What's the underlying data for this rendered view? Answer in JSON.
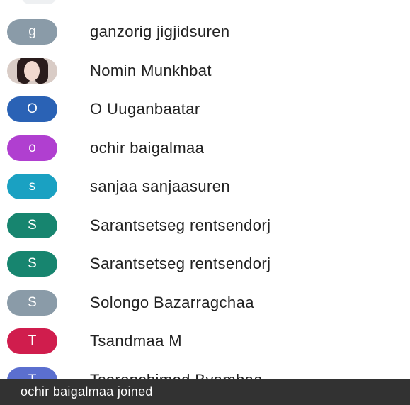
{
  "colors": {
    "gray": "#8a9ba8",
    "blue": "#2a62b5",
    "purple": "#b03fd0",
    "cyan": "#1aa1c2",
    "teal": "#17856f",
    "red": "#d01d4d",
    "indigo": "#5b6fcf",
    "toast_bg": "#323232"
  },
  "participants": [
    {
      "initial": "g",
      "name": "ganzorig jigjidsuren",
      "avatar_color": "#8a9ba8",
      "avatar_icon": "letter-avatar"
    },
    {
      "initial": "",
      "name": "Nomin Munkhbat",
      "avatar_color": "#d9ccc6",
      "avatar_icon": "photo-avatar"
    },
    {
      "initial": "O",
      "name": "O Uuganbaatar",
      "avatar_color": "#2a62b5",
      "avatar_icon": "letter-avatar"
    },
    {
      "initial": "o",
      "name": "ochir baigalmaa",
      "avatar_color": "#b03fd0",
      "avatar_icon": "letter-avatar"
    },
    {
      "initial": "s",
      "name": "sanjaa sanjaasuren",
      "avatar_color": "#1aa1c2",
      "avatar_icon": "letter-avatar"
    },
    {
      "initial": "S",
      "name": "Sarantsetseg rentsendorj",
      "avatar_color": "#17856f",
      "avatar_icon": "letter-avatar"
    },
    {
      "initial": "S",
      "name": "Sarantsetseg rentsendorj",
      "avatar_color": "#17856f",
      "avatar_icon": "letter-avatar"
    },
    {
      "initial": "S",
      "name": "Solongo Bazarragchaa",
      "avatar_color": "#8a9ba8",
      "avatar_icon": "letter-avatar"
    },
    {
      "initial": "T",
      "name": "Tsandmaa M",
      "avatar_color": "#d01d4d",
      "avatar_icon": "letter-avatar"
    },
    {
      "initial": "T",
      "name": "Tserenchimed Byambaa",
      "avatar_color": "#5b6fcf",
      "avatar_icon": "letter-avatar"
    }
  ],
  "toast": {
    "message": "ochir baigalmaa joined"
  }
}
